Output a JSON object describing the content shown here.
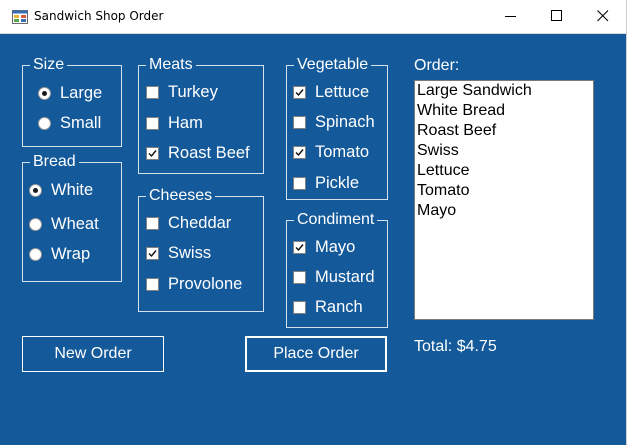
{
  "window": {
    "title": "Sandwich Shop Order"
  },
  "size": {
    "legend": "Size",
    "options": [
      {
        "label": "Large",
        "selected": true
      },
      {
        "label": "Small",
        "selected": false
      }
    ]
  },
  "bread": {
    "legend": "Bread",
    "options": [
      {
        "label": "White",
        "selected": true
      },
      {
        "label": "Wheat",
        "selected": false
      },
      {
        "label": "Wrap",
        "selected": false
      }
    ]
  },
  "meats": {
    "legend": "Meats",
    "options": [
      {
        "label": "Turkey",
        "checked": false
      },
      {
        "label": "Ham",
        "checked": false
      },
      {
        "label": "Roast Beef",
        "checked": true
      }
    ]
  },
  "cheeses": {
    "legend": "Cheeses",
    "options": [
      {
        "label": "Cheddar",
        "checked": false
      },
      {
        "label": "Swiss",
        "checked": true
      },
      {
        "label": "Provolone",
        "checked": false
      }
    ]
  },
  "vegetable": {
    "legend": "Vegetable",
    "options": [
      {
        "label": "Lettuce",
        "checked": true
      },
      {
        "label": "Spinach",
        "checked": false
      },
      {
        "label": "Tomato",
        "checked": true
      },
      {
        "label": "Pickle",
        "checked": false
      }
    ]
  },
  "condiment": {
    "legend": "Condiment",
    "options": [
      {
        "label": "Mayo",
        "checked": true
      },
      {
        "label": "Mustard",
        "checked": false
      },
      {
        "label": "Ranch",
        "checked": false
      }
    ]
  },
  "order": {
    "label": "Order:",
    "items": [
      "Large Sandwich",
      "White Bread",
      "Roast Beef",
      "Swiss",
      "Lettuce",
      "Tomato",
      "Mayo"
    ]
  },
  "total": "Total: $4.75",
  "buttons": {
    "new_order": "New Order",
    "place_order": "Place Order"
  },
  "colors": {
    "background": "#14599a",
    "text": "#ffffff",
    "list_background": "#ffffff"
  }
}
